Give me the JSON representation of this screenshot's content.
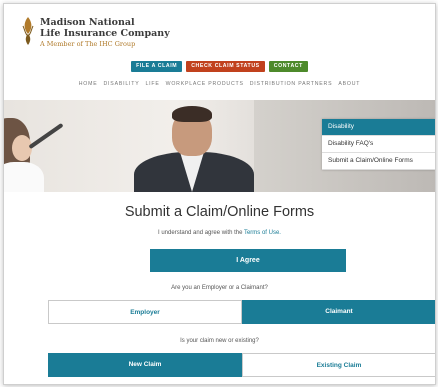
{
  "logo": {
    "line1": "Madison National",
    "line2": "Life Insurance Company",
    "line3": "A Member of The IHC Group"
  },
  "actions": {
    "file_claim": "FILE A CLAIM",
    "check_status": "CHECK CLAIM STATUS",
    "contact": "CONTACT"
  },
  "nav": [
    "HOME",
    "DISABILITY",
    "LIFE",
    "WORKPLACE PRODUCTS",
    "DISTRIBUTION PARTNERS",
    "ABOUT"
  ],
  "sidemenu": [
    "Disability",
    "Disability FAQ's",
    "Submit a Claim/Online Forms"
  ],
  "form": {
    "title": "Submit a Claim/Online Forms",
    "terms_prefix": "I understand and agree with the ",
    "terms_link": "Terms of Use.",
    "agree_button": "I Agree",
    "question_role": "Are you an Employer or a Claimant?",
    "employer": "Employer",
    "claimant": "Claimant",
    "question_claim": "Is your claim new or existing?",
    "new_claim": "New Claim",
    "existing_claim": "Existing Claim"
  },
  "colors": {
    "accent": "#1a7c96",
    "danger": "#c1411d",
    "success": "#4d8a2b"
  }
}
